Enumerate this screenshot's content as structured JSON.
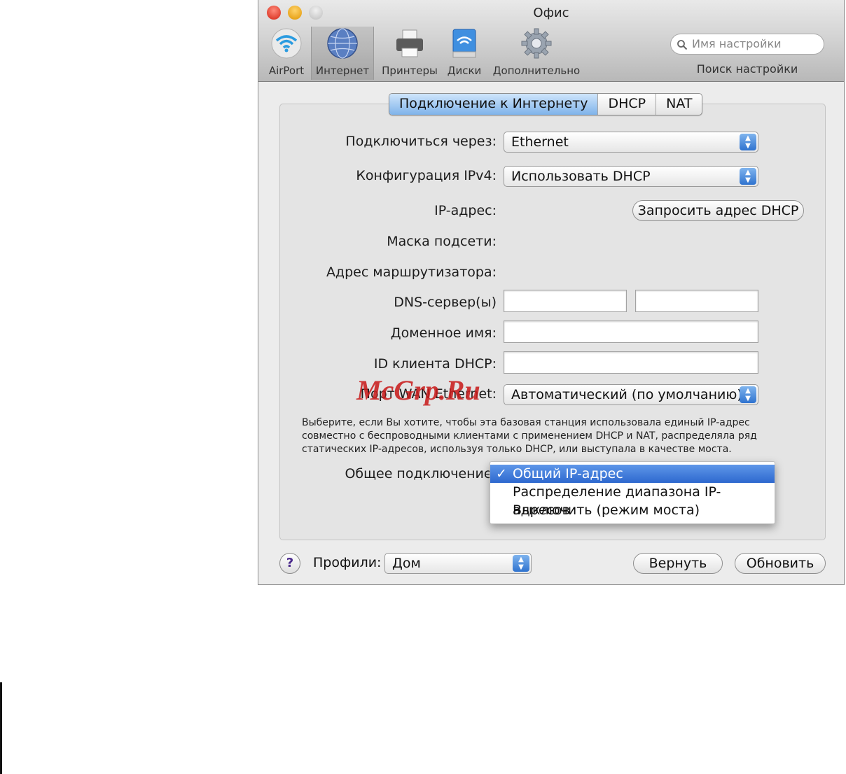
{
  "window": {
    "title": "Офис"
  },
  "toolbar": {
    "items": [
      {
        "label": "AirPort",
        "icon": "airport-icon"
      },
      {
        "label": "Интернет",
        "icon": "internet-icon"
      },
      {
        "label": "Принтеры",
        "icon": "printer-icon"
      },
      {
        "label": "Диски",
        "icon": "disk-icon"
      },
      {
        "label": "Дополнительно",
        "icon": "gear-icon"
      }
    ],
    "search_placeholder": "Имя настройки",
    "search_label": "Поиск настройки"
  },
  "tabs": [
    "Подключение к Интернету",
    "DHCP",
    "NAT"
  ],
  "form": {
    "connect_via_label": "Подключиться через:",
    "connect_via_value": "Ethernet",
    "ipv4_label": "Конфигурация IPv4:",
    "ipv4_value": "Использовать DHCP",
    "ip_label": "IP-адрес:",
    "renew_button": "Запросить адрес DHCP",
    "subnet_label": "Маска подсети:",
    "router_label": "Адрес маршрутизатора:",
    "dns_label": "DNS-сервер(ы)",
    "domain_label": "Доменное имя:",
    "client_id_label": "ID клиента DHCP:",
    "wan_port_label": "Порт WAN Ethernet:",
    "wan_port_value": "Автоматический (по умолчанию)",
    "description": "Выберите, если Вы хотите, чтобы эта базовая станция использовала единый IP-адрес совместно с беспроводными клиентами с применением DHCP и NAT, распределяла ряд статических IP-адресов, используя только DHCP, или выступала в качестве моста.",
    "sharing_label": "Общее подключение:"
  },
  "sharing_menu": {
    "options": [
      "Общий IP-адрес",
      "Распределение диапазона IP-адресов",
      "Выключить (режим моста)"
    ],
    "selected": "Общий IP-адрес",
    "checkmark": "✓"
  },
  "footer": {
    "help": "?",
    "profiles_label": "Профили:",
    "profiles_value": "Дом",
    "revert_button": "Вернуть",
    "update_button": "Обновить"
  },
  "watermark": "McGrp.Ru",
  "colors": {
    "accent": "#3a78d6",
    "watermark": "#c81e1e"
  }
}
